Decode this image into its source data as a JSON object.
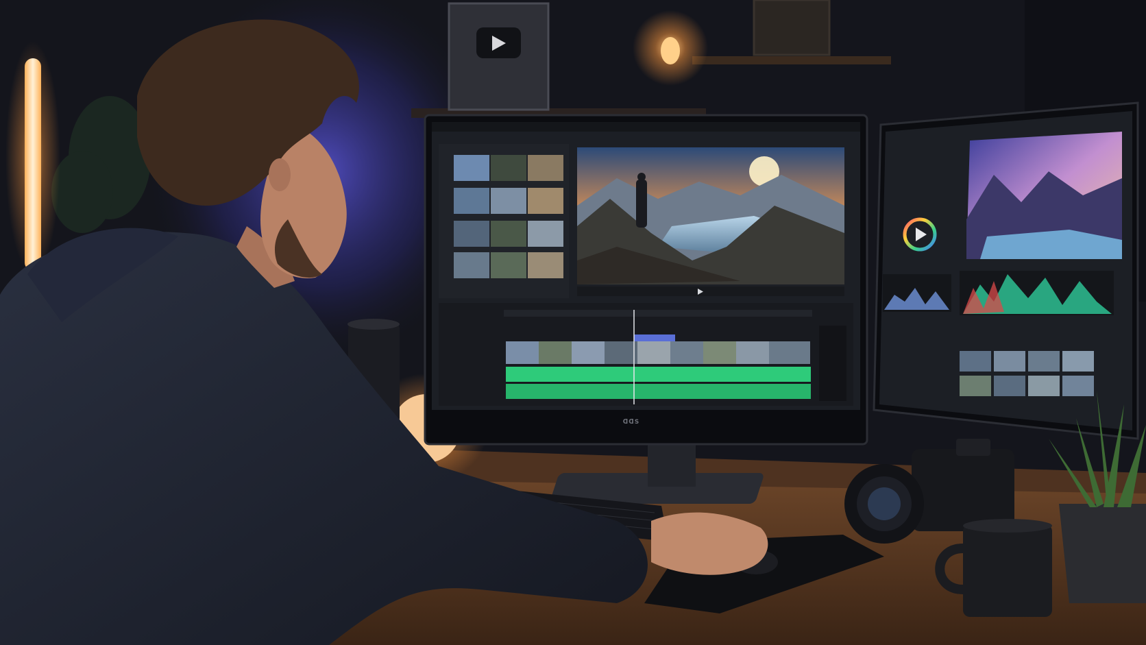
{
  "scene": {
    "monitor_brand": "ᗡᗡS",
    "colors": {
      "wall_dark": "#14151c",
      "wall_blue_glow": "#3d3fa0",
      "lamp_warm": "#ffb56a",
      "desk_wood": "#5a3a24",
      "ui_panel": "#1e2127",
      "audio_waveform": "#2ecb7a",
      "sky_sunset": "#f3b66a",
      "lake_blue": "#8fb8d6"
    }
  }
}
